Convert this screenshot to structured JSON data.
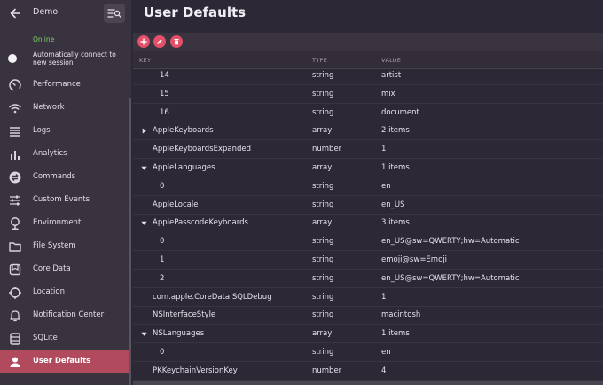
{
  "sidebar": {
    "app_name": "Demo",
    "status": "Online",
    "auto_connect_label": "Automatically connect to new session",
    "items": [
      {
        "label": "Performance",
        "icon": "gauge-icon"
      },
      {
        "label": "Network",
        "icon": "wifi-icon"
      },
      {
        "label": "Logs",
        "icon": "list-icon"
      },
      {
        "label": "Analytics",
        "icon": "bar-chart-icon"
      },
      {
        "label": "Commands",
        "icon": "commands-icon"
      },
      {
        "label": "Custom Events",
        "icon": "sliders-icon"
      },
      {
        "label": "Environment",
        "icon": "pin-icon"
      },
      {
        "label": "File System",
        "icon": "folder-icon"
      },
      {
        "label": "Core Data",
        "icon": "database-icon"
      },
      {
        "label": "Location",
        "icon": "crosshair-icon"
      },
      {
        "label": "Notification Center",
        "icon": "bell-icon"
      },
      {
        "label": "SQLite",
        "icon": "sqlite-icon"
      },
      {
        "label": "User Defaults",
        "icon": "user-icon"
      }
    ],
    "active_item": "User Defaults"
  },
  "main": {
    "title": "User Defaults",
    "columns": {
      "key": "KEY",
      "type": "TYPE",
      "value": "VALUE"
    },
    "rows": [
      {
        "key": "14",
        "type": "string",
        "value": "artist",
        "level": 1,
        "disclosure": ""
      },
      {
        "key": "15",
        "type": "string",
        "value": "mix",
        "level": 1,
        "disclosure": ""
      },
      {
        "key": "16",
        "type": "string",
        "value": "document",
        "level": 1,
        "disclosure": ""
      },
      {
        "key": "AppleKeyboards",
        "type": "array",
        "value": "2 items",
        "level": 0,
        "disclosure": "collapsed"
      },
      {
        "key": "AppleKeyboardsExpanded",
        "type": "number",
        "value": "1",
        "level": 0,
        "disclosure": ""
      },
      {
        "key": "AppleLanguages",
        "type": "array",
        "value": "1 items",
        "level": 0,
        "disclosure": "expanded"
      },
      {
        "key": "0",
        "type": "string",
        "value": "en",
        "level": 1,
        "disclosure": ""
      },
      {
        "key": "AppleLocale",
        "type": "string",
        "value": "en_US",
        "level": 0,
        "disclosure": ""
      },
      {
        "key": "ApplePasscodeKeyboards",
        "type": "array",
        "value": "3 items",
        "level": 0,
        "disclosure": "expanded"
      },
      {
        "key": "0",
        "type": "string",
        "value": "en_US@sw=QWERTY;hw=Automatic",
        "level": 1,
        "disclosure": ""
      },
      {
        "key": "1",
        "type": "string",
        "value": "emoji@sw=Emoji",
        "level": 1,
        "disclosure": ""
      },
      {
        "key": "2",
        "type": "string",
        "value": "en_US@sw=QWERTY;hw=Automatic",
        "level": 1,
        "disclosure": ""
      },
      {
        "key": "com.apple.CoreData.SQLDebug",
        "type": "string",
        "value": "1",
        "level": 0,
        "disclosure": ""
      },
      {
        "key": "NSInterfaceStyle",
        "type": "string",
        "value": "macintosh",
        "level": 0,
        "disclosure": ""
      },
      {
        "key": "NSLanguages",
        "type": "array",
        "value": "1 items",
        "level": 0,
        "disclosure": "expanded"
      },
      {
        "key": "0",
        "type": "string",
        "value": "en",
        "level": 1,
        "disclosure": ""
      },
      {
        "key": "PKKeychainVersionKey",
        "type": "number",
        "value": "4",
        "level": 0,
        "disclosure": ""
      }
    ]
  },
  "toolbar": {
    "add_icon": "plus-icon",
    "edit_icon": "pencil-icon",
    "delete_icon": "trash-icon"
  },
  "colors": {
    "accent": "#e2506a",
    "active_nav": "#b24a5d",
    "online": "#7fd36b"
  }
}
